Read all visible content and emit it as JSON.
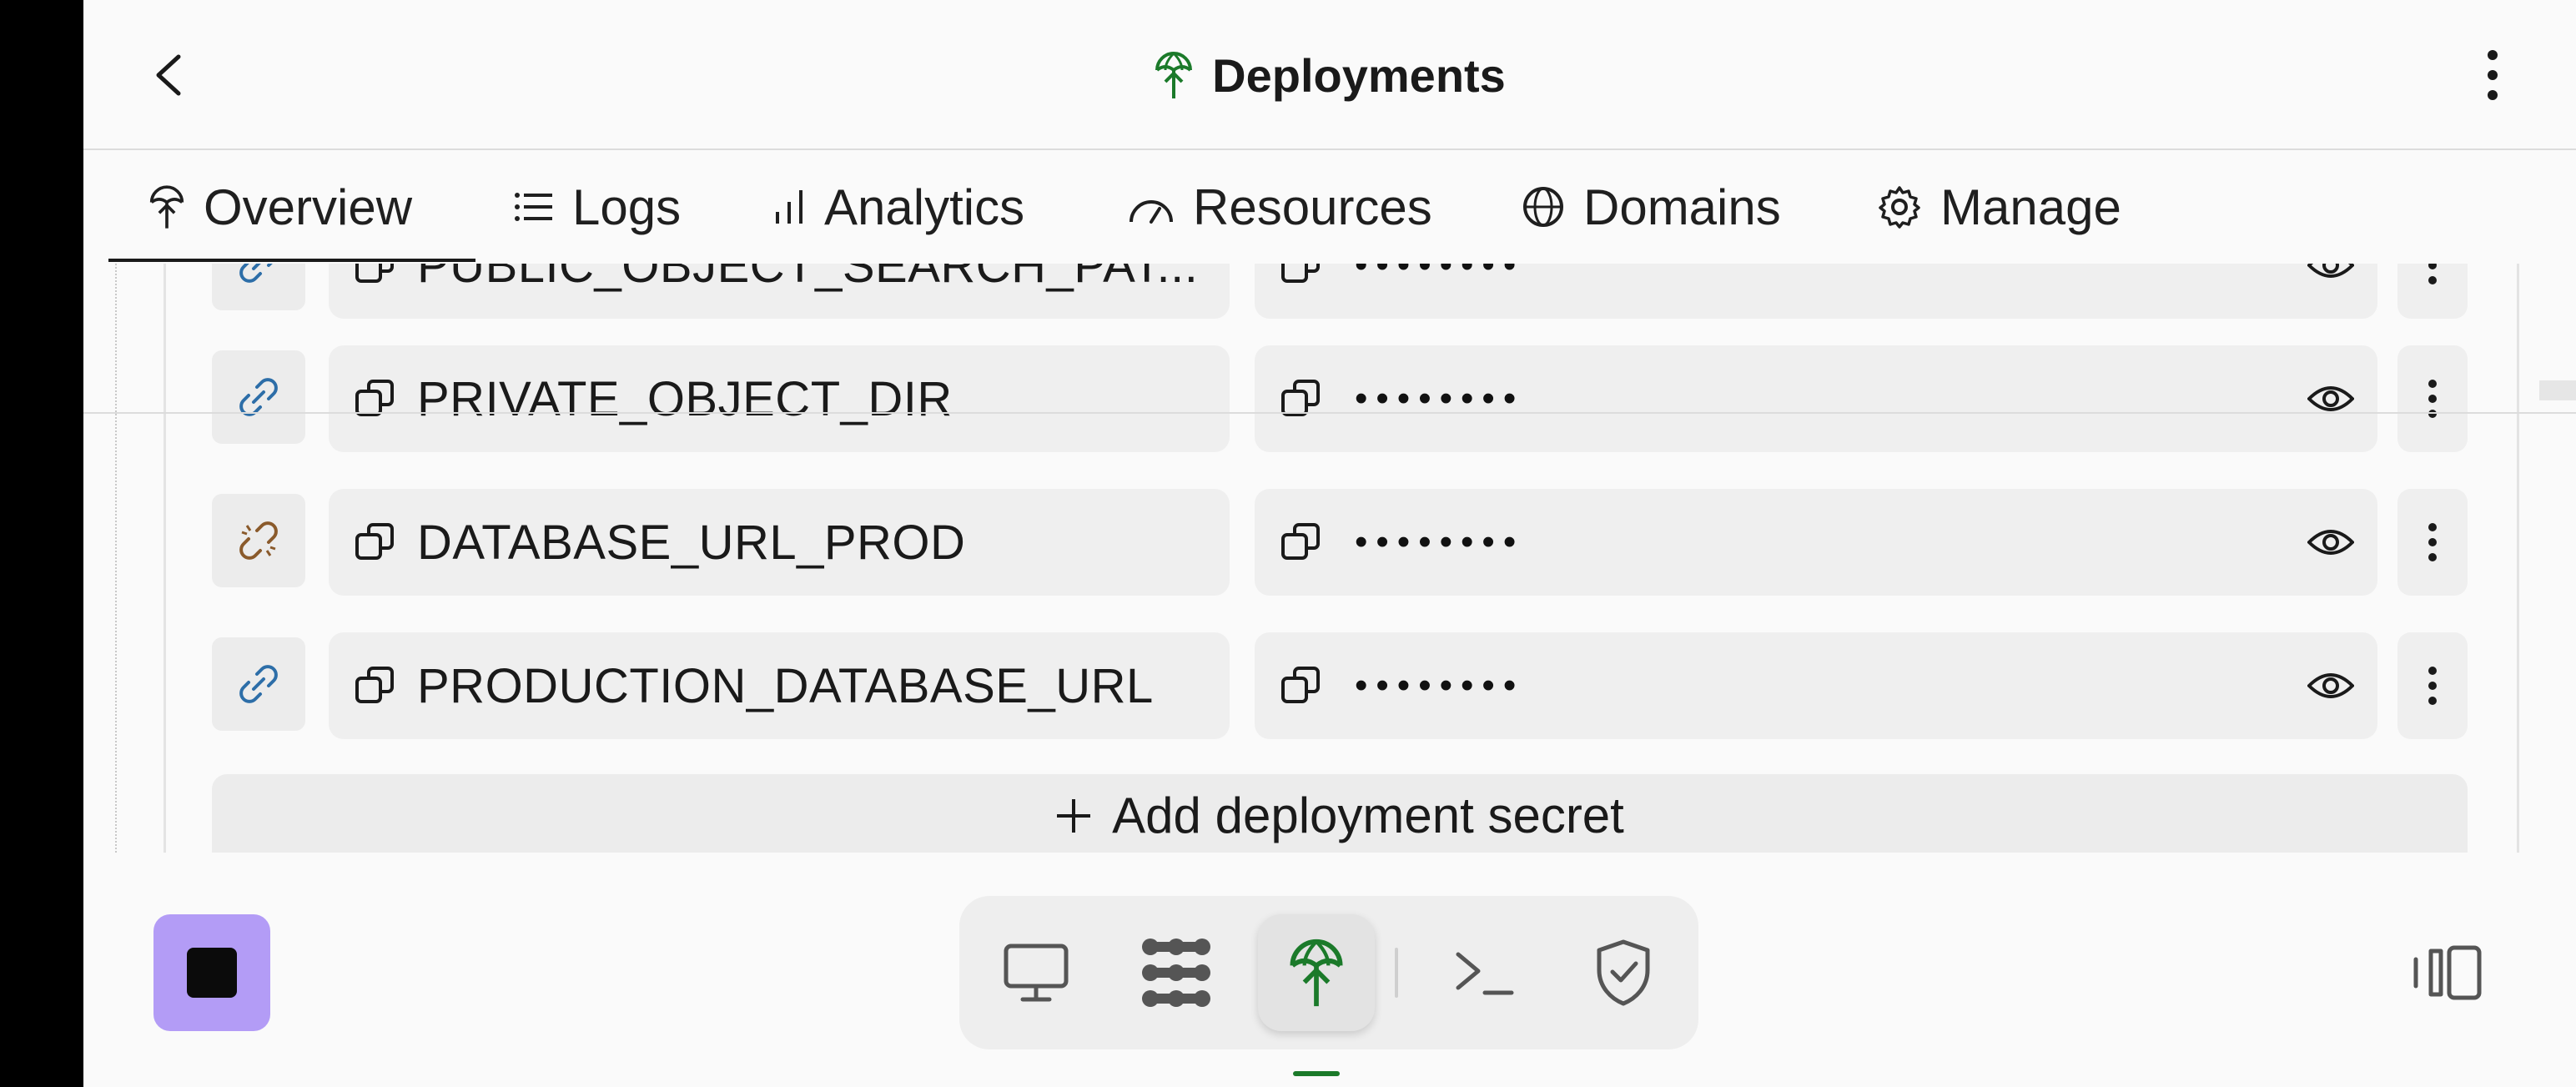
{
  "header": {
    "title": "Deployments"
  },
  "tabs": [
    {
      "label": "Overview",
      "icon": "deploy-umbrella-icon",
      "active": true
    },
    {
      "label": "Logs",
      "icon": "list-icon",
      "active": false
    },
    {
      "label": "Analytics",
      "icon": "bar-chart-icon",
      "active": false
    },
    {
      "label": "Resources",
      "icon": "gauge-icon",
      "active": false
    },
    {
      "label": "Domains",
      "icon": "globe-icon",
      "active": false
    },
    {
      "label": "Manage",
      "icon": "gear-icon",
      "active": false
    }
  ],
  "secrets": [
    {
      "key": "PUBLIC_OBJECT_SEARCH_PAT...",
      "value": "••••••••",
      "link_status": "linked",
      "partially_visible": true
    },
    {
      "key": "PRIVATE_OBJECT_DIR",
      "value": "••••••••",
      "link_status": "linked"
    },
    {
      "key": "DATABASE_URL_PROD",
      "value": "••••••••",
      "link_status": "unlinked"
    },
    {
      "key": "PRODUCTION_DATABASE_URL",
      "value": "••••••••",
      "link_status": "linked"
    }
  ],
  "add_secret_label": "Add deployment secret",
  "dock": {
    "items": [
      {
        "icon": "monitor-icon"
      },
      {
        "icon": "apps-icon"
      },
      {
        "icon": "deploy-umbrella-icon",
        "active": true
      },
      {
        "icon": "terminal-icon"
      },
      {
        "icon": "shield-check-icon"
      }
    ]
  },
  "colors": {
    "accent_green": "#1b7a2a",
    "stop_button": "#b39cf6",
    "link_blue": "#2d6ea8",
    "unlink_brown": "#8a5a2b"
  }
}
